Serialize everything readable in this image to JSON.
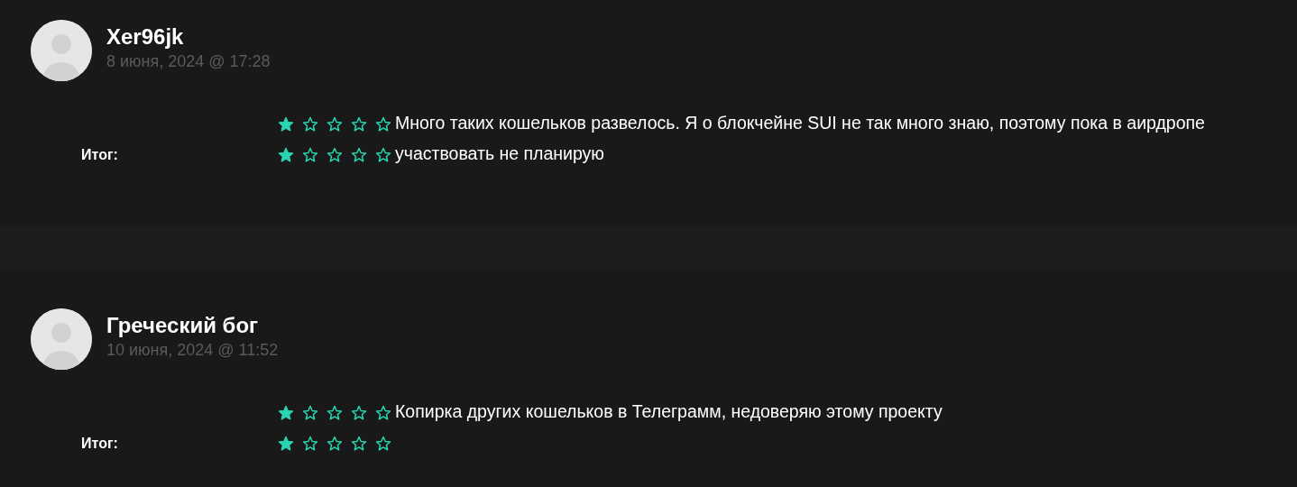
{
  "reviews": [
    {
      "author": "Xer96jk",
      "date": "8 июня, 2024 @ 17:28",
      "ratings": [
        {
          "stars": 1
        },
        {
          "label": "Итог:",
          "stars": 1
        }
      ],
      "text": "Много таких кошельков развелось. Я о блокчейне SUI не так много знаю, поэтому пока в аирдропе участвовать не планирую"
    },
    {
      "author": "Греческий бог",
      "date": "10 июня, 2024 @ 11:52",
      "ratings": [
        {
          "stars": 1
        },
        {
          "label": "Итог:",
          "stars": 1
        }
      ],
      "text": "Копирка других кошельков в Телеграмм, недоверяю этому проекту"
    }
  ]
}
